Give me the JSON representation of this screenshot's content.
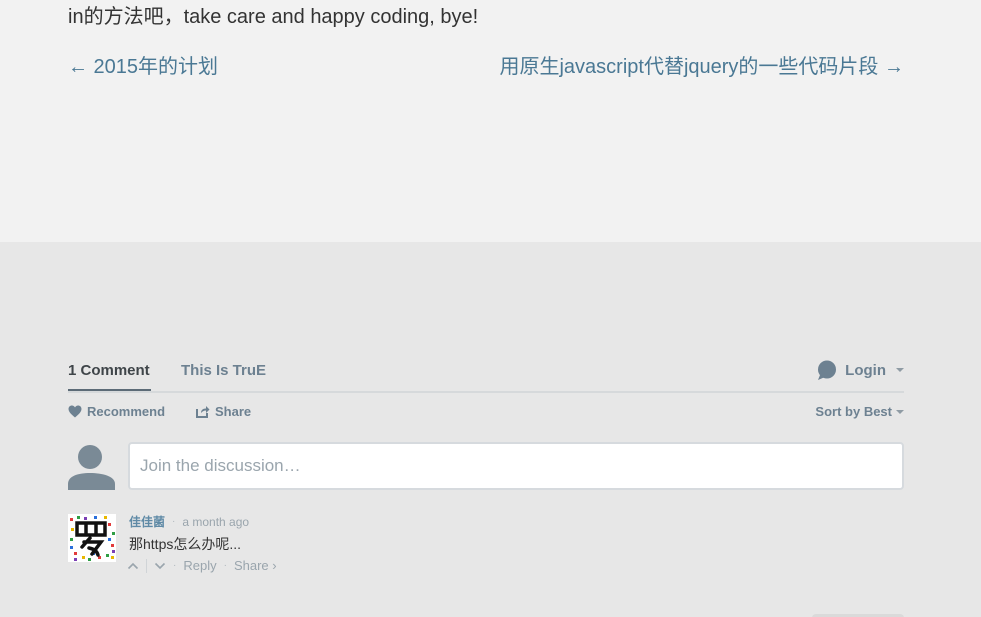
{
  "article": {
    "tail_text": "in的方法吧，take care and happy coding, bye!",
    "prev_link": "← 2015年的计划",
    "next_link": "用原生javascript代替jquery的一些代码片段 →"
  },
  "comments": {
    "tab_count": "1 Comment",
    "tab_community": "This Is TruE",
    "login_label": "Login",
    "recommend_label": "Recommend",
    "share_label": "Share",
    "sort_label": "Sort by Best",
    "input_placeholder": "Join the discussion…",
    "items": [
      {
        "author": "佳佳菌",
        "time": "a month ago",
        "body": "那https怎么办呢...",
        "reply_label": "Reply",
        "share_label": "Share ›"
      }
    ]
  },
  "colors": {
    "link": "#4a7894",
    "muted": "#6d8191",
    "author": "#5f8aa6"
  },
  "icons": [
    "chat-bubble-icon",
    "heart-icon",
    "share-icon",
    "default-avatar-icon",
    "upvote-icon",
    "downvote-icon",
    "caret-down-icon"
  ]
}
